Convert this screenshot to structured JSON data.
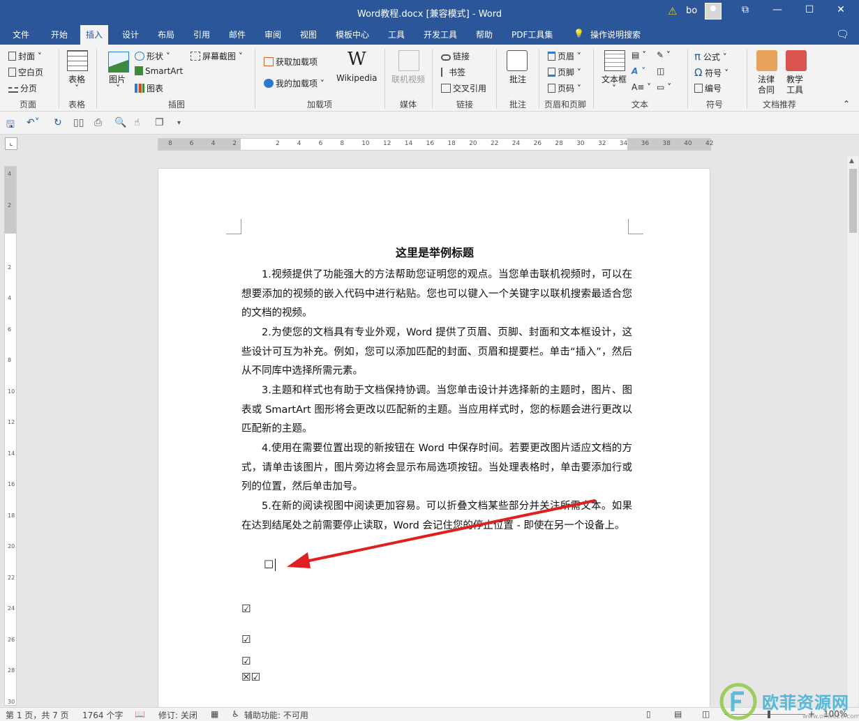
{
  "window": {
    "title": "Word教程.docx [兼容模式]  -  Word",
    "user": "bo",
    "controls": [
      "⧉",
      "—",
      "☐",
      "✕"
    ]
  },
  "tabs": [
    "文件",
    "开始",
    "插入",
    "设计",
    "布局",
    "引用",
    "邮件",
    "审阅",
    "视图",
    "模板中心",
    "工具",
    "开发工具",
    "帮助",
    "PDF工具集"
  ],
  "tell_me": "操作说明搜索",
  "ribbon": {
    "pages": {
      "cover": "封面",
      "blank": "空白页",
      "break": "分页",
      "group": "页面"
    },
    "tables": {
      "table": "表格",
      "group": "表格"
    },
    "illustrations": {
      "picture": "图片",
      "shapes": "形状",
      "smartart": "SmartArt",
      "chart": "图表",
      "screenshot": "屏幕截图",
      "group": "插图"
    },
    "addins": {
      "get": "获取加载项",
      "mine": "我的加载项",
      "wikipedia": "Wikipedia",
      "group": "加载项"
    },
    "media": {
      "online_video_1": "联机视频",
      "group": "媒体"
    },
    "links": {
      "link": "链接",
      "bookmark": "书签",
      "crossref": "交叉引用",
      "group": "链接"
    },
    "comments": {
      "comment": "批注",
      "group": "批注"
    },
    "header_footer": {
      "header": "页眉",
      "footer": "页脚",
      "page_number": "页码",
      "group": "页眉和页脚"
    },
    "text": {
      "textbox_1": "文本框",
      "group": "文本"
    },
    "symbols": {
      "equation": "公式",
      "symbol": "符号",
      "number": "编号",
      "group": "符号"
    },
    "recommend": {
      "law_1": "法律",
      "law_2": "合同",
      "teach_1": "教学",
      "teach_2": "工具",
      "group": "文档推荐"
    }
  },
  "document": {
    "title": "这里是举例标题",
    "paragraphs": [
      "1.视频提供了功能强大的方法帮助您证明您的观点。当您单击联机视频时，可以在想要添加的视频的嵌入代码中进行粘贴。您也可以键入一个关键字以联机搜索最适合您的文档的视频。",
      "2.为使您的文档具有专业外观，Word 提供了页眉、页脚、封面和文本框设计，这些设计可互为补充。例如，您可以添加匹配的封面、页眉和提要栏。单击“插入”，然后从不同库中选择所需元素。",
      "3.主题和样式也有助于文档保持协调。当您单击设计并选择新的主题时，图片、图表或 SmartArt 图形将会更改以匹配新的主题。当应用样式时，您的标题会进行更改以匹配新的主题。",
      "4.使用在需要位置出现的新按钮在 Word 中保存时间。若要更改图片适应文档的方式，请单击该图片，图片旁边将会显示布局选项按钮。当处理表格时，单击要添加行或列的位置，然后单击加号。",
      "5.在新的阅读视图中阅读更加容易。可以折叠文档某些部分并关注所需文本。如果在达到结尾处之前需要停止读取，Word 会记住您的停止位置 - 即使在另一个设备上。"
    ],
    "checkbox_empty": "□",
    "checkbox_checked": "☑",
    "checkbox_crossed": "☒",
    "last_line": "☒☑"
  },
  "ruler": {
    "h_numbers": [
      "8",
      "6",
      "4",
      "2",
      "",
      "2",
      "4",
      "6",
      "8",
      "10",
      "12",
      "14",
      "16",
      "18",
      "20",
      "22",
      "24",
      "26",
      "28",
      "30",
      "32",
      "34",
      "36",
      "38",
      "40",
      "42"
    ],
    "v_numbers": [
      "4",
      "2",
      "",
      "2",
      "4",
      "6",
      "8",
      "10",
      "12",
      "14",
      "16",
      "18",
      "20",
      "22",
      "24",
      "26",
      "28",
      "30"
    ]
  },
  "status": {
    "page": "第 1 页，共 7 页",
    "words": "1764 个字",
    "track": "修订: 关闭",
    "accessibility": "辅助功能: 不可用",
    "zoom": "100%",
    "zoom_minus": "-",
    "zoom_plus": "+"
  },
  "watermark": {
    "text": "欧菲资源网",
    "url": "www.office26.com"
  },
  "colors": {
    "accent": "#2b579a",
    "arrow": "#e02020",
    "watermark": "#3ab0d8"
  }
}
